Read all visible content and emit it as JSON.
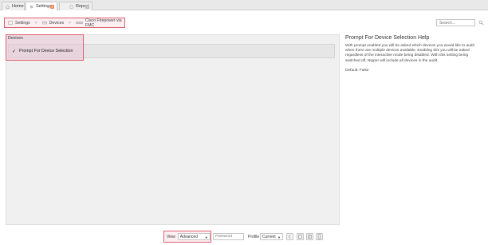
{
  "tabs": [
    {
      "label": "Home",
      "icon": "home-icon",
      "active": false
    },
    {
      "label": "Settings",
      "icon": "gear-icon",
      "active": true,
      "close_icon": "close-icon"
    },
    {
      "label": "Report",
      "icon": "document-icon",
      "active": false,
      "close_icon": "close-icon"
    }
  ],
  "breadcrumb": {
    "items": [
      {
        "label": "Settings",
        "icon": "settings-page-icon"
      },
      {
        "label": "Devices",
        "icon": "devices-icon"
      },
      {
        "label": "Cisco Firepower via FMC",
        "icon": "firewall-device-icon"
      }
    ],
    "separator": ">"
  },
  "search": {
    "placeholder": "Search..."
  },
  "devices_panel": {
    "header": "Devices",
    "option_label": "Prompt For Device Selection",
    "option_checked": true
  },
  "help": {
    "title": "Prompt For Device Selection Help",
    "body": "With prompt enabled you will be asked which devices you would like to audit when there are multiple devices available. Enabling this you will be asked regardless of the interactive mode being disabled. With this setting being switched off, Nipper will include all devices in the audit.",
    "default": "Default: False"
  },
  "bottom_toolbar": {
    "view_label": "View",
    "view_value": "Advanced",
    "password_placeholder": "Password",
    "profile_label": "Profile",
    "profile_value": "Current"
  },
  "colors": {
    "highlight_border": "#e0606e",
    "highlight_fill": "#e8c4d6",
    "tab_badge": "#f08a5d"
  }
}
